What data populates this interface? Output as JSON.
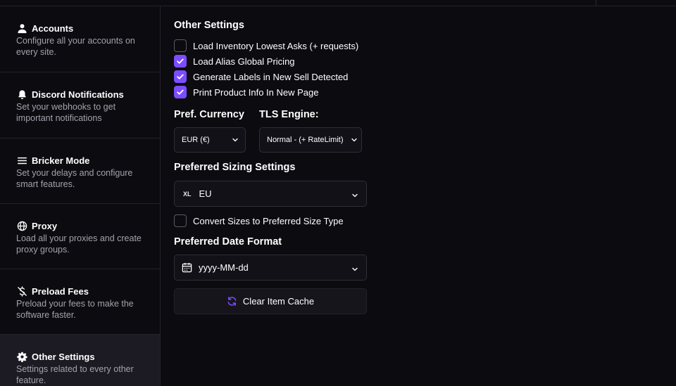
{
  "sidebar": {
    "items": [
      {
        "icon": "user-icon",
        "title": "Accounts",
        "desc": "Configure all your accounts on every site."
      },
      {
        "icon": "bell-icon",
        "title": "Discord Notifications",
        "desc": "Set your webhooks to get important notifications"
      },
      {
        "icon": "menu-icon",
        "title": "Bricker Mode",
        "desc": "Set your delays and configure smart features."
      },
      {
        "icon": "globe-icon",
        "title": "Proxy",
        "desc": "Load all your proxies and create proxy groups."
      },
      {
        "icon": "dollar-off-icon",
        "title": "Preload Fees",
        "desc": "Preload your fees to make the software faster."
      },
      {
        "icon": "gear-icon",
        "title": "Other Settings",
        "desc": "Settings related to every other feature.",
        "active": true
      }
    ]
  },
  "main": {
    "heading": "Other Settings",
    "checkboxes": [
      {
        "label": "Load Inventory Lowest Asks (+ requests)",
        "checked": false
      },
      {
        "label": "Load Alias Global Pricing",
        "checked": true
      },
      {
        "label": "Generate Labels in New Sell Detected",
        "checked": true
      },
      {
        "label": "Print Product Info In New Page",
        "checked": true
      }
    ],
    "currency": {
      "label": "Pref. Currency",
      "value": "EUR (€)"
    },
    "tls": {
      "label": "TLS Engine:",
      "value": "Normal - (+ RateLimit)"
    },
    "sizing": {
      "label": "Preferred Sizing Settings",
      "icon_text": "XL",
      "value": "EU"
    },
    "convert": {
      "label": "Convert Sizes to Preferred Size Type",
      "checked": false
    },
    "date": {
      "label": "Preferred Date Format",
      "value": "yyyy-MM-dd"
    },
    "clear_button": "Clear Item Cache"
  },
  "colors": {
    "accent": "#7c4dff",
    "background": "#0c0b10",
    "active_item": "#1c1b23"
  }
}
